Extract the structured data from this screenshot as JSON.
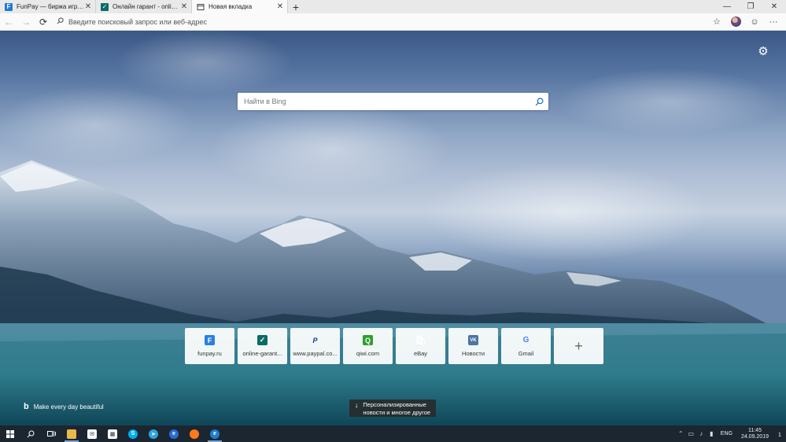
{
  "tabs": [
    {
      "title": "FunPay — биржа игровых ценностей",
      "favicon": "F",
      "favicon_color": "#1e7bd8",
      "active": false
    },
    {
      "title": "Онлайн гарант - online-garant.net",
      "favicon": "✓",
      "favicon_color": "#0c6b63",
      "active": false
    },
    {
      "title": "Новая вкладка",
      "favicon": "",
      "favicon_color": "#555",
      "active": true
    }
  ],
  "toolbar": {
    "address_placeholder": "Введите поисковый запрос или веб-адрес"
  },
  "search": {
    "placeholder": "Найти в Bing"
  },
  "quick_links": [
    {
      "label": "funpay.ru",
      "glyph": "F",
      "color": "#2a7fe0"
    },
    {
      "label": "online-garant...",
      "glyph": "✓",
      "color": "#0c6b63"
    },
    {
      "label": "www.paypal.co...",
      "glyph": "P",
      "color": "#0b3f8c"
    },
    {
      "label": "qiwi.com",
      "glyph": "Q",
      "color": "#2f9e2f"
    },
    {
      "label": "eBay",
      "glyph": "🛍",
      "color": "#e53238"
    },
    {
      "label": "Новости",
      "glyph": "VK",
      "color": "#4c75a3"
    },
    {
      "label": "Gmail",
      "glyph": "G",
      "color": "#ffffff"
    }
  ],
  "tagline": "Make every day beautiful",
  "news_button": {
    "line1": "Персонализированные",
    "line2": "новости и многое другое"
  },
  "taskbar": {
    "lang": "ENG",
    "time": "11:45",
    "date": "24.09.2019",
    "notification_count": "1"
  }
}
